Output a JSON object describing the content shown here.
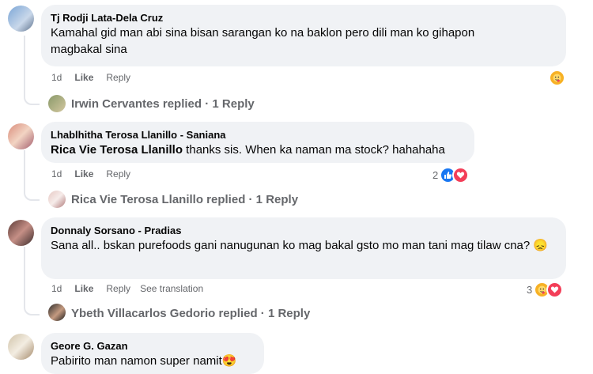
{
  "comments": [
    {
      "author": "Tj Rodji Lata-Dela Cruz",
      "tag": "",
      "text": "Kamahal gid man abi sina bisan sarangan ko na baklon pero dili man ko gihapon magbakal sina",
      "time": "1d",
      "like_label": "Like",
      "reply_label": "Reply",
      "see_translation": "",
      "reaction_count": "",
      "reactions": [
        "care"
      ],
      "replies_label": "Irwin Cervantes replied · 1 Reply"
    },
    {
      "author": "Lhablhitha Terosa Llanillo - Saniana",
      "tag": "Rica Vie Terosa Llanillo",
      "text": " thanks sis. When ka naman ma stock? hahahaha",
      "time": "1d",
      "like_label": "Like",
      "reply_label": "Reply",
      "see_translation": "",
      "reaction_count": "2",
      "reactions": [
        "like",
        "love"
      ],
      "replies_label": "Rica Vie Terosa Llanillo replied · 1 Reply"
    },
    {
      "author": "Donnaly Sorsano - Pradias",
      "tag": "",
      "text": "Sana all.. bskan purefoods gani nanugunan ko mag bakal gsto mo man tani mag tilaw cna? 😞",
      "time": "1d",
      "like_label": "Like",
      "reply_label": "Reply",
      "see_translation": "See translation",
      "reaction_count": "3",
      "reactions": [
        "care",
        "love"
      ],
      "replies_label": "Ybeth Villacarlos Gedorio replied · 1 Reply"
    },
    {
      "author": "Geore G. Gazan",
      "tag": "",
      "text": "Pabirito man namon super namit😍",
      "time": "",
      "like_label": "",
      "reply_label": "",
      "see_translation": "",
      "reaction_count": "",
      "reactions": [],
      "replies_label": ""
    }
  ],
  "colors": {
    "bubble": "#f0f2f5",
    "meta_text": "#65676b",
    "like_blue": "#1877f2",
    "love_red": "#f33e58",
    "care_yellow": "#f7b125"
  }
}
